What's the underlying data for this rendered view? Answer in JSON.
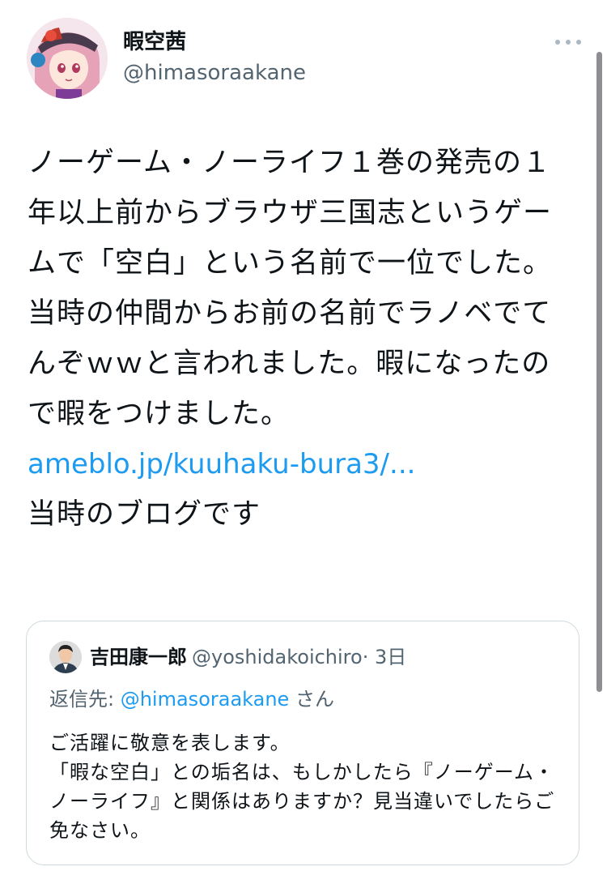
{
  "author": {
    "display_name": "暇空茜",
    "handle": "@himasoraakane",
    "avatar_icon": "anime-avatar-icon"
  },
  "tweet": {
    "lines": [
      "ノーゲーム・ノーライフ１巻の発売の１年以上前からブラウザ三国志というゲームで「空白」という名前で一位でした。当時の仲間からお前の名前でラノベでてんぞｗｗと言われました。暇になったので暇をつけました。"
    ],
    "link": "ameblo.jp/kuuhaku-bura3/...",
    "after_link": "当時のブログです"
  },
  "quoted": {
    "display_name": "吉田康一郎",
    "handle": "@yoshidakoichiro",
    "time": "· 3日",
    "reply_prefix": "返信先: ",
    "reply_mention": "@himasoraakane",
    "reply_suffix": " さん",
    "lines": [
      "ご活躍に敬意を表します。",
      "「暇な空白」との垢名は、もしかしたら『ノーゲーム・ノーライフ』と関係はありますか？見当違いでしたらご免なさい。"
    ]
  },
  "colors": {
    "link": "#1d9bf0",
    "secondary_text": "#536471",
    "border": "#cfd9de"
  }
}
